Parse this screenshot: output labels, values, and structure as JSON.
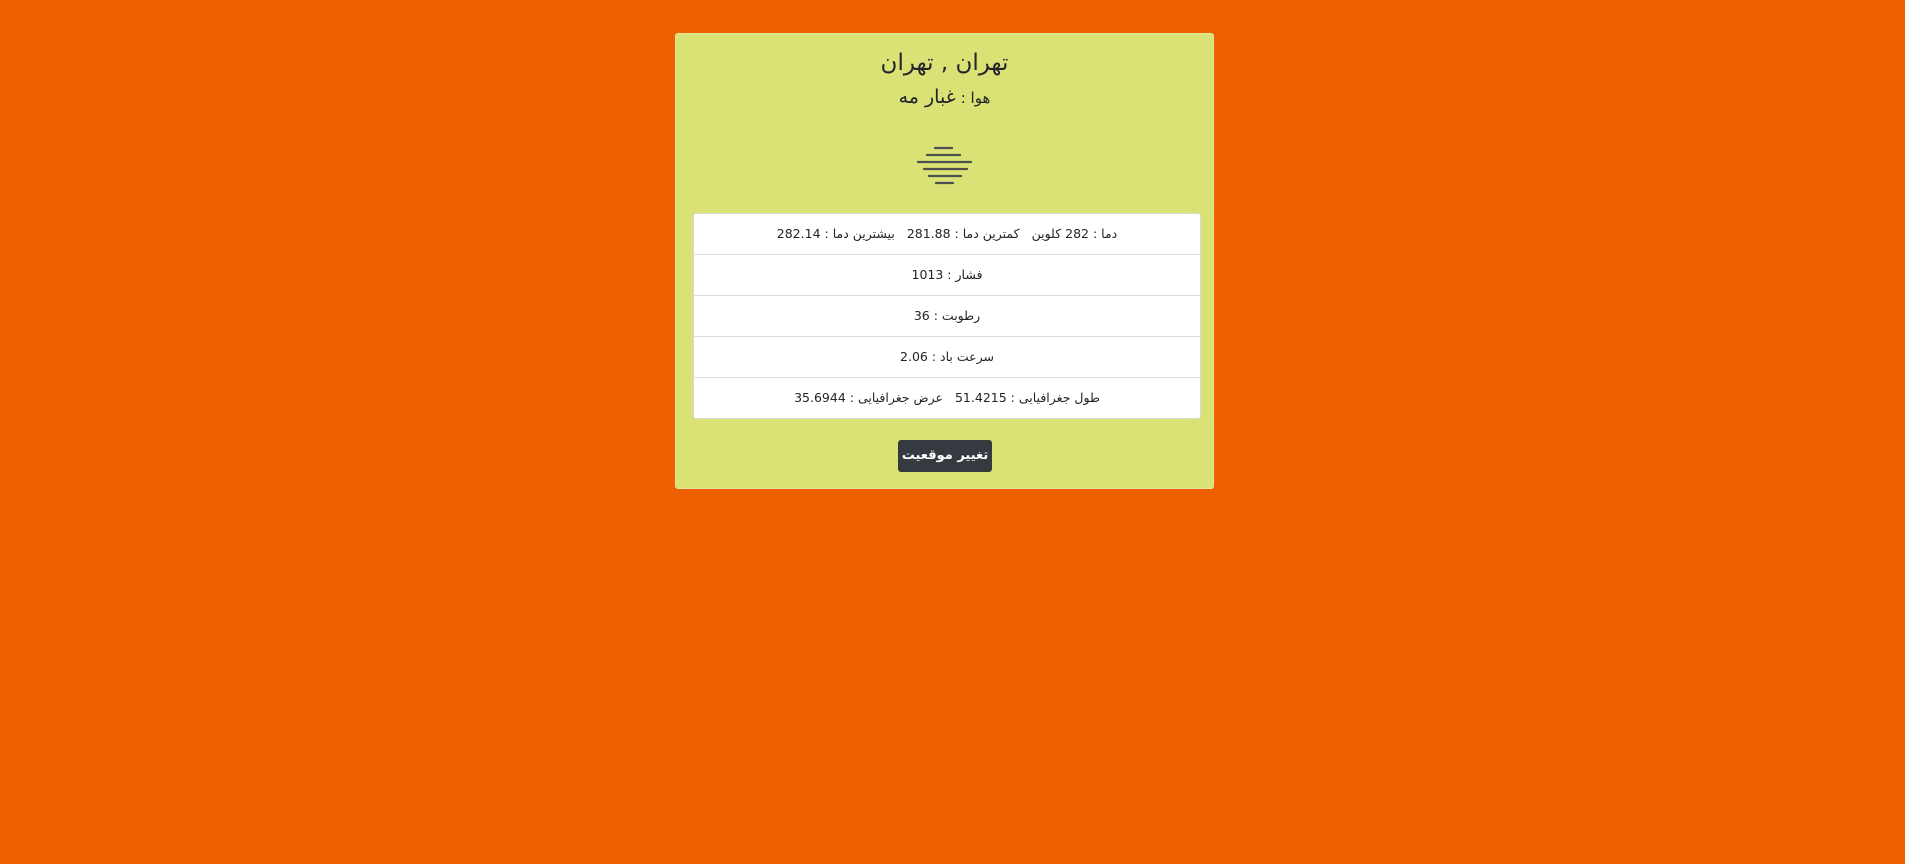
{
  "location": {
    "title": "تهران , تهران"
  },
  "weather": {
    "label": "هوا :",
    "value": "غبار مه",
    "icon": "fog-icon"
  },
  "details": {
    "temperature": {
      "temp": "دما : 282 کلوین",
      "min": "کمترین دما : 281.88",
      "max": "بیشترین دما : 282.14"
    },
    "pressure": "فشار : 1013",
    "humidity": "رطوبت : 36",
    "wind": "سرعت باد : 2.06",
    "coordinates": {
      "lon": "طول جغرافیایی : 51.4215",
      "lat": "عرض جغرافیایی : 35.6944"
    }
  },
  "actions": {
    "change_location_label": "تغییر موقعیت"
  },
  "colors": {
    "page_background": "#ee6102",
    "card_background": "#dbe275",
    "button_background": "#343a40"
  }
}
